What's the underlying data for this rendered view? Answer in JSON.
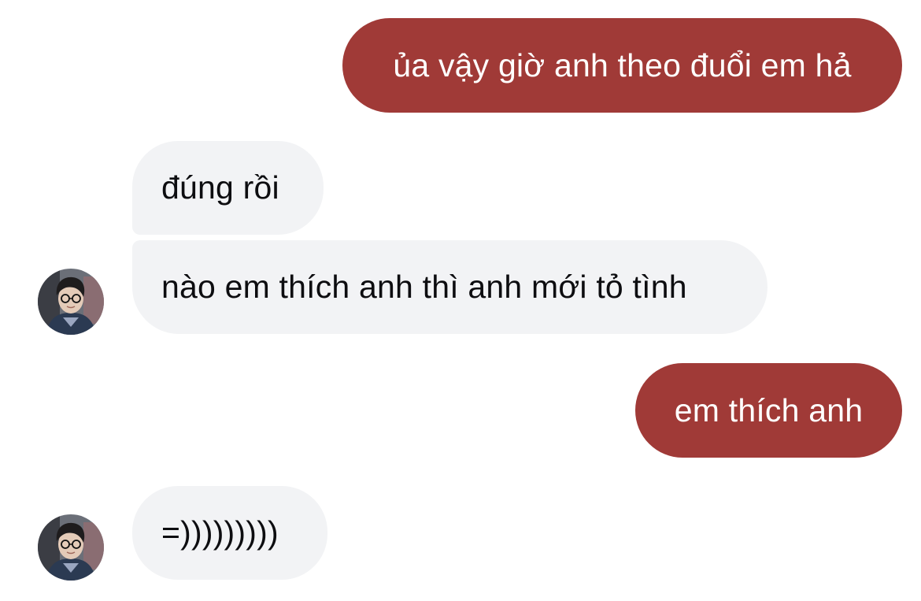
{
  "conversation": {
    "messages": [
      {
        "sender": "me",
        "text": "ủa vậy giờ anh theo đuổi em hả"
      },
      {
        "sender": "them",
        "text": "đúng rồi"
      },
      {
        "sender": "them",
        "text": "nào em thích anh thì anh mới tỏ tình"
      },
      {
        "sender": "me",
        "text": "em thích anh"
      },
      {
        "sender": "them",
        "text": "=)))))))))"
      }
    ]
  },
  "colors": {
    "sent_bubble": "#a03a37",
    "received_bubble": "#f2f3f5",
    "sent_text": "#ffffff",
    "received_text": "#0d0d10"
  },
  "avatar": {
    "icon": "profile-photo"
  }
}
